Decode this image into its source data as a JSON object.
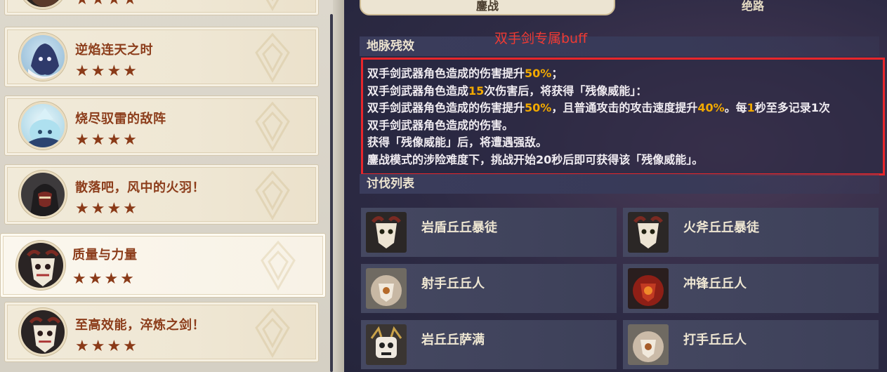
{
  "left_list": {
    "cards": [
      {
        "title": "",
        "stars": "★★★★",
        "avatar": "dark-hooded-avatar"
      },
      {
        "title": "逆焰连天之时",
        "stars": "★★★★",
        "avatar": "abyss-mage-avatar"
      },
      {
        "title": "烧尽驭雷的敌阵",
        "stars": "★★★★",
        "avatar": "cryo-slime-avatar"
      },
      {
        "title": "散落吧，风中的火羽！",
        "stars": "★★★★",
        "avatar": "fatui-agent-avatar"
      },
      {
        "title": "质量与力量",
        "stars": "★★★★",
        "avatar": "hilichurl-mask-avatar"
      },
      {
        "title": "至高效能，淬炼之剑！",
        "stars": "★★★★",
        "avatar": "hilichurl-mask-avatar"
      }
    ]
  },
  "tabs": {
    "tab1": "鏖战",
    "tab2": "绝路"
  },
  "annotation": "双手剑专属buff",
  "effect_section": {
    "title": "地脉残效",
    "lines": [
      [
        {
          "t": "双手剑武器角色造成的伤害提升"
        },
        {
          "t": "50%",
          "hl": true
        },
        {
          "t": "；"
        }
      ],
      [
        {
          "t": "双手剑武器角色造成"
        },
        {
          "t": "15",
          "hl": true
        },
        {
          "t": "次伤害后，将获得「残像威能」："
        }
      ],
      [
        {
          "t": "双手剑武器角色造成的伤害提升"
        },
        {
          "t": "50%",
          "hl": true
        },
        {
          "t": "，且普通攻击的攻击速度提升"
        },
        {
          "t": "40%",
          "hl": true
        },
        {
          "t": "。每"
        },
        {
          "t": "1",
          "hl": true
        },
        {
          "t": "秒至多记录1次"
        }
      ],
      [
        {
          "t": "双手剑武器角色造成的伤害。"
        }
      ],
      [
        {
          "t": "获得「残像威能」后，将遭遇强敌。"
        }
      ],
      [
        {
          "t": "鏖战模式的涉险难度下，挑战开始20秒后即可获得该「残像威能」。"
        }
      ]
    ]
  },
  "enemies_section": {
    "title": "讨伐列表",
    "items": [
      {
        "name": "岩盾丘丘暴徒",
        "icon": "mitachurl-mask-icon"
      },
      {
        "name": "火斧丘丘暴徒",
        "icon": "mitachurl-mask-icon"
      },
      {
        "name": "射手丘丘人",
        "icon": "hilichurl-shooter-icon"
      },
      {
        "name": "冲锋丘丘人",
        "icon": "hilichurl-berserker-icon"
      },
      {
        "name": "岩丘丘萨满",
        "icon": "samachurl-icon"
      },
      {
        "name": "打手丘丘人",
        "icon": "hilichurl-fighter-icon"
      }
    ]
  },
  "colors": {
    "accent_red": "#e8262b",
    "highlight": "#f2a900",
    "card_title": "#8c3d1b"
  }
}
